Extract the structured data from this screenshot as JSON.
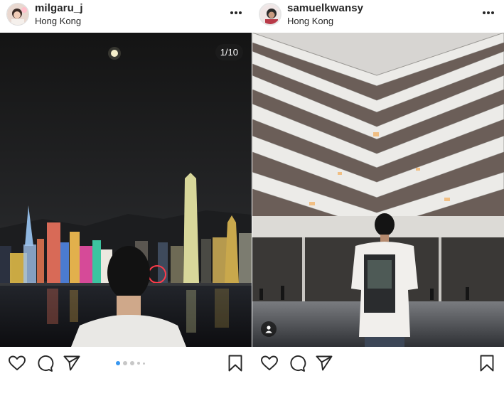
{
  "posts": [
    {
      "username": "milgaru_j",
      "location": "Hong Kong",
      "media_counter": "1/10",
      "carousel_index": 1,
      "carousel_total": 10
    },
    {
      "username": "samuelkwansy",
      "location": "Hong Kong"
    }
  ],
  "icons": {
    "like": "heart-icon",
    "comment": "comment-icon",
    "share": "paper-plane-icon",
    "save": "bookmark-icon",
    "more": "more-options-icon",
    "tag": "user-tag-icon"
  },
  "colors": {
    "text": "#262626",
    "carousel_active": "#3897f0",
    "carousel_inactive": "#c7c7c7"
  }
}
